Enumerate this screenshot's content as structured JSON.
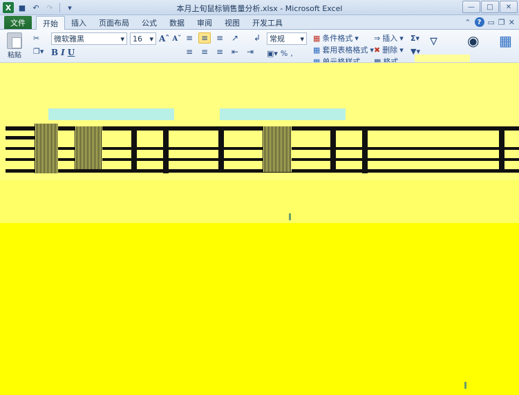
{
  "titlebar": {
    "app_icon": "X",
    "title": "本月上旬鼠标销售量分析.xlsx - Microsoft Excel"
  },
  "tabs": {
    "file": "文件",
    "items": [
      "开始",
      "插入",
      "页面布局",
      "公式",
      "数据",
      "审阅",
      "视图",
      "开发工具"
    ],
    "active_index": 0
  },
  "ribbon": {
    "paste": "粘贴",
    "font_name": "微软雅黑",
    "font_size": "16",
    "number_format": "常规",
    "styles": {
      "conditional": "条件格式",
      "table": "套用表格格式",
      "cell": "单元格样式"
    },
    "cells": {
      "insert": "插入",
      "delete": "删除",
      "format": "格式"
    }
  },
  "colors": {
    "accent": "#1f7a3f",
    "sheet_bg": "#ffff99",
    "garble": "#111111",
    "cyan": "#b8f0e6"
  }
}
